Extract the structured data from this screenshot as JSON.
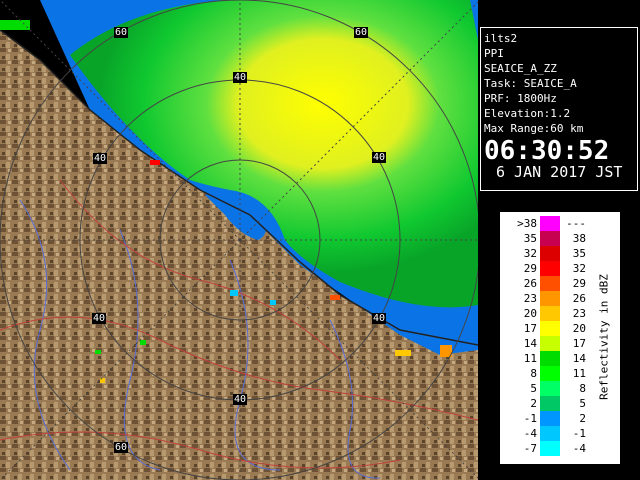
{
  "map": {
    "range_rings": [
      {
        "label": "60"
      },
      {
        "label": "60"
      },
      {
        "label": "40"
      },
      {
        "label": "40"
      },
      {
        "label": "40"
      },
      {
        "label": "40"
      },
      {
        "label": "40"
      },
      {
        "label": "40"
      },
      {
        "label": "60"
      }
    ]
  },
  "info": {
    "station": "ilts2",
    "scan_type": "PPI",
    "product": "SEAICE_A_ZZ",
    "task": "Task: SEAICE_A",
    "prf": "PRF: 1800Hz",
    "elevation": "Elevation:1.2",
    "max_range": "Max Range:60 km",
    "time": "06:30:52",
    "date": "6 JAN 2017 JST"
  },
  "legend": {
    "axis_label": "Reflectivity in dBZ",
    "rows": [
      {
        "lo": ">38",
        "hi": "---",
        "color": "#ff00ff"
      },
      {
        "lo": "35",
        "hi": "38",
        "color": "#c80050"
      },
      {
        "lo": "32",
        "hi": "35",
        "color": "#dc0000"
      },
      {
        "lo": "29",
        "hi": "32",
        "color": "#ff0000"
      },
      {
        "lo": "26",
        "hi": "29",
        "color": "#ff5000"
      },
      {
        "lo": "23",
        "hi": "26",
        "color": "#ff9600"
      },
      {
        "lo": "20",
        "hi": "23",
        "color": "#ffc800"
      },
      {
        "lo": "17",
        "hi": "20",
        "color": "#ffff00"
      },
      {
        "lo": "14",
        "hi": "17",
        "color": "#c8ff00"
      },
      {
        "lo": "11",
        "hi": "14",
        "color": "#00dc00"
      },
      {
        "lo": "8",
        "hi": "11",
        "color": "#00ff00"
      },
      {
        "lo": "5",
        "hi": "8",
        "color": "#00ff64"
      },
      {
        "lo": "2",
        "hi": "5",
        "color": "#00c864"
      },
      {
        "lo": "-1",
        "hi": "2",
        "color": "#0096ff"
      },
      {
        "lo": "-4",
        "hi": "-1",
        "color": "#00c8ff"
      },
      {
        "lo": "-7",
        "hi": "-4",
        "color": "#00ffff"
      }
    ]
  }
}
